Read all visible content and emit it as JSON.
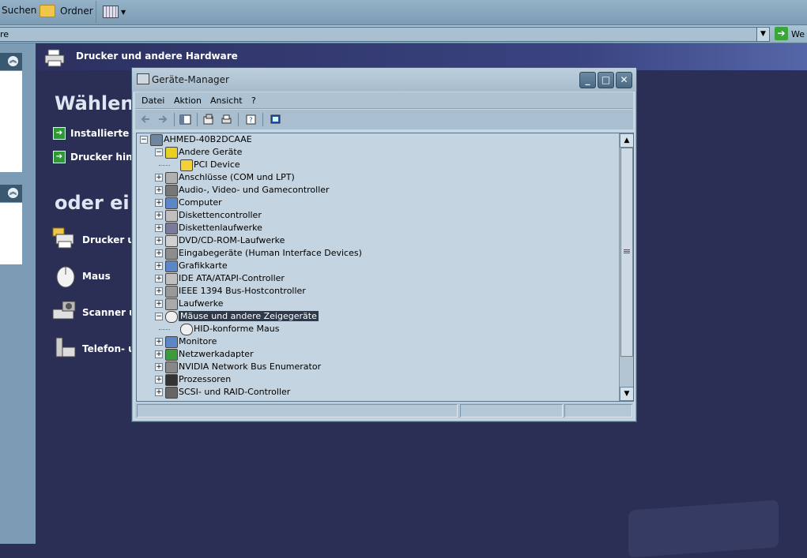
{
  "explorer": {
    "toolbar": {
      "search_label": "Suchen",
      "folders_label": "Ordner"
    },
    "address": {
      "value": "re",
      "go_label": "We"
    },
    "header_title": "Drucker und andere Hardware",
    "heading_pick_task": "Wählen",
    "tasks": [
      "Installierte Dr",
      "Drucker hinzu"
    ],
    "heading_pick_icon": "oder ei",
    "picks": [
      "Drucker un",
      "Maus",
      "Scanner ur",
      "Telefon- ur"
    ]
  },
  "device_manager": {
    "title": "Geräte-Manager",
    "menu": [
      "Datei",
      "Aktion",
      "Ansicht",
      "?"
    ],
    "tree": [
      {
        "label": "AHMED-40B2DCAAE",
        "level": 0,
        "expander": "-",
        "icon": "computer-icon"
      },
      {
        "label": "Andere Geräte",
        "level": 1,
        "expander": "-",
        "icon": "unknown-device-icon"
      },
      {
        "label": "PCI Device",
        "level": 2,
        "expander": "",
        "icon": "warning-device-icon"
      },
      {
        "label": "Anschlüsse (COM und LPT)",
        "level": 1,
        "expander": "+",
        "icon": "port-icon"
      },
      {
        "label": "Audio-, Video- und Gamecontroller",
        "level": 1,
        "expander": "+",
        "icon": "audio-icon"
      },
      {
        "label": "Computer",
        "level": 1,
        "expander": "+",
        "icon": "monitor-icon"
      },
      {
        "label": "Diskettencontroller",
        "level": 1,
        "expander": "+",
        "icon": "controller-icon"
      },
      {
        "label": "Diskettenlaufwerke",
        "level": 1,
        "expander": "+",
        "icon": "floppy-icon"
      },
      {
        "label": "DVD/CD-ROM-Laufwerke",
        "level": 1,
        "expander": "+",
        "icon": "cd-drive-icon"
      },
      {
        "label": "Eingabegeräte (Human Interface Devices)",
        "level": 1,
        "expander": "+",
        "icon": "hid-icon"
      },
      {
        "label": "Grafikkarte",
        "level": 1,
        "expander": "+",
        "icon": "display-adapter-icon"
      },
      {
        "label": "IDE ATA/ATAPI-Controller",
        "level": 1,
        "expander": "+",
        "icon": "controller-icon"
      },
      {
        "label": "IEEE 1394 Bus-Hostcontroller",
        "level": 1,
        "expander": "+",
        "icon": "firewire-icon"
      },
      {
        "label": "Laufwerke",
        "level": 1,
        "expander": "+",
        "icon": "drive-icon"
      },
      {
        "label": "Mäuse und andere Zeigegeräte",
        "level": 1,
        "expander": "-",
        "icon": "mouse-icon",
        "selected": true
      },
      {
        "label": "HID-konforme Maus",
        "level": 2,
        "expander": "",
        "icon": "mouse-icon"
      },
      {
        "label": "Monitore",
        "level": 1,
        "expander": "+",
        "icon": "monitor-icon"
      },
      {
        "label": "Netzwerkadapter",
        "level": 1,
        "expander": "+",
        "icon": "network-card-icon"
      },
      {
        "label": "NVIDIA Network Bus Enumerator",
        "level": 1,
        "expander": "+",
        "icon": "bus-icon"
      },
      {
        "label": "Prozessoren",
        "level": 1,
        "expander": "+",
        "icon": "cpu-icon"
      },
      {
        "label": "SCSI- und RAID-Controller",
        "level": 1,
        "expander": "+",
        "icon": "scsi-icon"
      }
    ]
  },
  "colors": {
    "selection": "#2e3a4a",
    "desktop": "#2b2f55",
    "pane": "#7c9bb4"
  }
}
